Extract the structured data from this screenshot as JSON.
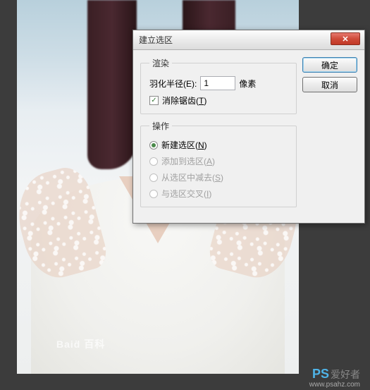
{
  "dialog": {
    "title": "建立选区",
    "close_icon": "✕",
    "ok_label": "确定",
    "cancel_label": "取消",
    "render": {
      "legend": "渲染",
      "feather_label": "羽化半径(E):",
      "feather_value": "1",
      "feather_unit": "像素",
      "antialias_label": "消除锯齿(T)",
      "antialias_checked": "✓"
    },
    "operation": {
      "legend": "操作",
      "new_label": "新建选区(N)",
      "add_label": "添加到选区(A)",
      "subtract_label": "从选区中减去(S)",
      "intersect_label": "与选区交叉(I)"
    }
  },
  "watermark": {
    "left_text": "Baiḋ 百科",
    "brand": "PS",
    "brand_suffix": "爱好者",
    "url": "www.psahz.com"
  }
}
